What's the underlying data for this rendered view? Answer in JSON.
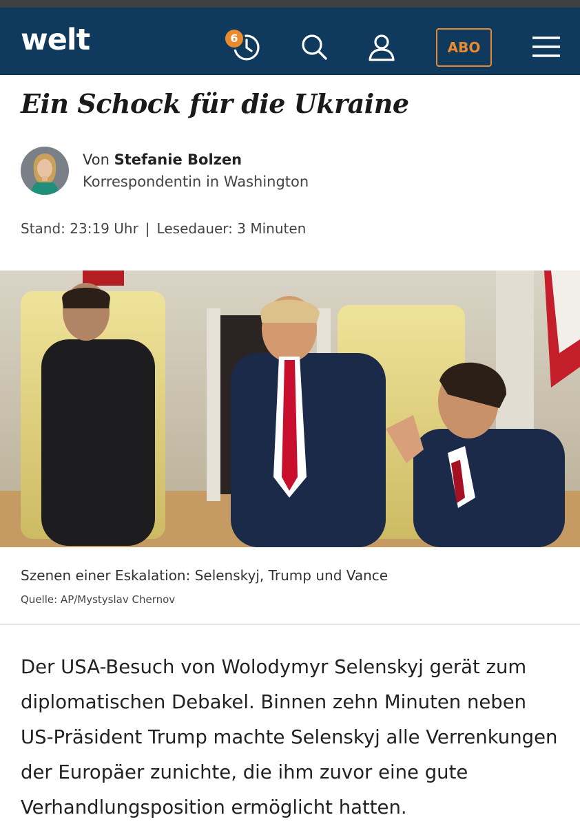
{
  "header": {
    "logo_text": "WELT",
    "badge_count": "6",
    "abo_label": "ABO",
    "icons": [
      "history-icon",
      "search-icon",
      "user-icon",
      "menu-icon"
    ],
    "colors": {
      "bar": "#0f3a5d",
      "accent": "#e98a2f"
    }
  },
  "article": {
    "headline": "Ein Schock für die Ukraine",
    "author_prefix": "Von",
    "author_name": "Stefanie Bolzen",
    "author_role": "Korrespondentin in Washington",
    "stand": "Stand: 23:19 Uhr",
    "separator": "|",
    "read_time": "Lesedauer: 3 Minuten",
    "image_caption": "Szenen einer Eskalation: Selenskyj, Trump und Vance",
    "image_credit": "Quelle: AP/Mystyslav Chernov",
    "lead": "Der USA-Besuch von Wolodymyr Selenskyj gerät zum diplomatischen Debakel. Binnen zehn Minuten neben US-Präsident Trump machte Selenskyj alle Verrenkungen der Europäer zunichte, die ihm zuvor eine gute Verhandlungsposition ermöglicht hatten."
  }
}
